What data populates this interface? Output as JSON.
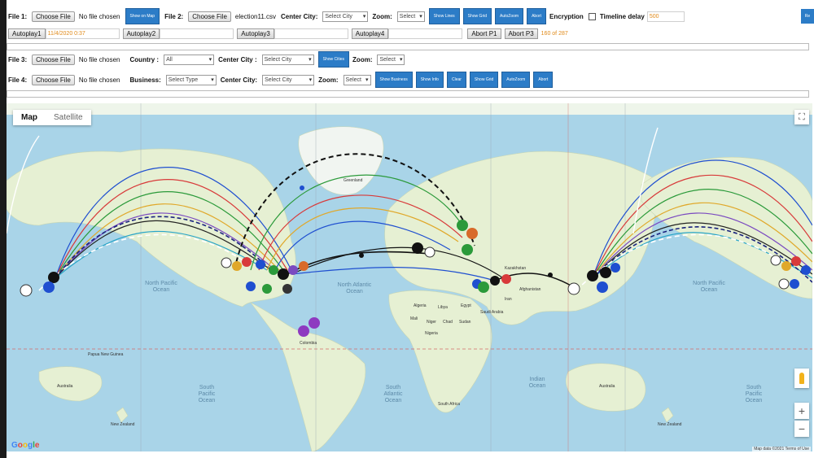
{
  "colors": {
    "accent_button": "#2c7cc7",
    "status_orange": "#e08a1a",
    "ocean": "#a9d4e8",
    "land": "#e6f0d3",
    "greenland": "#f1f5f1"
  },
  "row1": {
    "file1_label": "File 1:",
    "choose_file": "Choose File",
    "no_file": "No file chosen",
    "show_on_map": "Show on Map",
    "file2_label": "File 2:",
    "file2_name": "election11.csv",
    "center_city_label": "Center City:",
    "center_city_value": "Select City",
    "zoom_label": "Zoom:",
    "zoom_value": "Select",
    "show_lines": "Show Lines",
    "show_grid": "Show Grid",
    "autozoom": "AutoZoom",
    "abort": "Abort",
    "encryption_label": "Encryption",
    "timeline_delay_label": "Timeline delay",
    "timeline_delay_value": "500",
    "cut_button": "Re"
  },
  "row2": {
    "autoplay1": "Autoplay1",
    "autoplay1_time": "11/4/2020 0:37",
    "autoplay2": "Autoplay2",
    "autoplay3": "Autoplay3",
    "autoplay4": "Autoplay4",
    "abort_p1": "Abort P1",
    "abort_p3": "Abort P3",
    "progress_count": "160 of 287"
  },
  "row3": {
    "file3_label": "File 3:",
    "choose_file": "Choose File",
    "no_file": "No file chosen",
    "country_label": "Country :",
    "country_value": "All",
    "center_city_label": "Center City :",
    "center_city_value": "Select City",
    "show_cities": "Show Cities",
    "zoom_label": "Zoom:",
    "zoom_value": "Select"
  },
  "row4": {
    "file4_label": "File 4:",
    "choose_file": "Choose File",
    "no_file": "No file chosen",
    "business_label": "Business:",
    "business_value": "Select Type",
    "center_city_label": "Center City:",
    "center_city_value": "Select City",
    "zoom_label": "Zoom:",
    "zoom_value": "Select",
    "show_business": "Show Business",
    "show_info": "Show Info",
    "clear": "Clear",
    "show_grid": "Show Grid",
    "autozoom": "AutoZoom",
    "abort": "Abort"
  },
  "progress": {
    "bar1": 0.0,
    "bar2": 0.0
  },
  "map": {
    "tab_map": "Map",
    "tab_satellite": "Satellite",
    "zoom_in": "+",
    "zoom_out": "−",
    "fullscreen": "⛶",
    "google": "Google",
    "attribution": "Map data ©2021   Terms of Use",
    "oceans": [
      "North Pacific Ocean",
      "North Atlantic Ocean",
      "South Pacific Ocean",
      "South Atlantic Ocean",
      "Indian Ocean",
      "North Pacific Ocean",
      "South Pacific Ocean"
    ],
    "places": [
      "Greenland",
      "Australia",
      "New Zealand",
      "Papua New Guinea",
      "Colombia",
      "Algeria",
      "Libya",
      "Egypt",
      "Mali",
      "Niger",
      "Chad",
      "Sudan",
      "Nigeria",
      "South Africa",
      "Saudi Arabia",
      "Iran",
      "Kazakhstan",
      "Afghanistan",
      "Australia",
      "New Zealand"
    ]
  }
}
